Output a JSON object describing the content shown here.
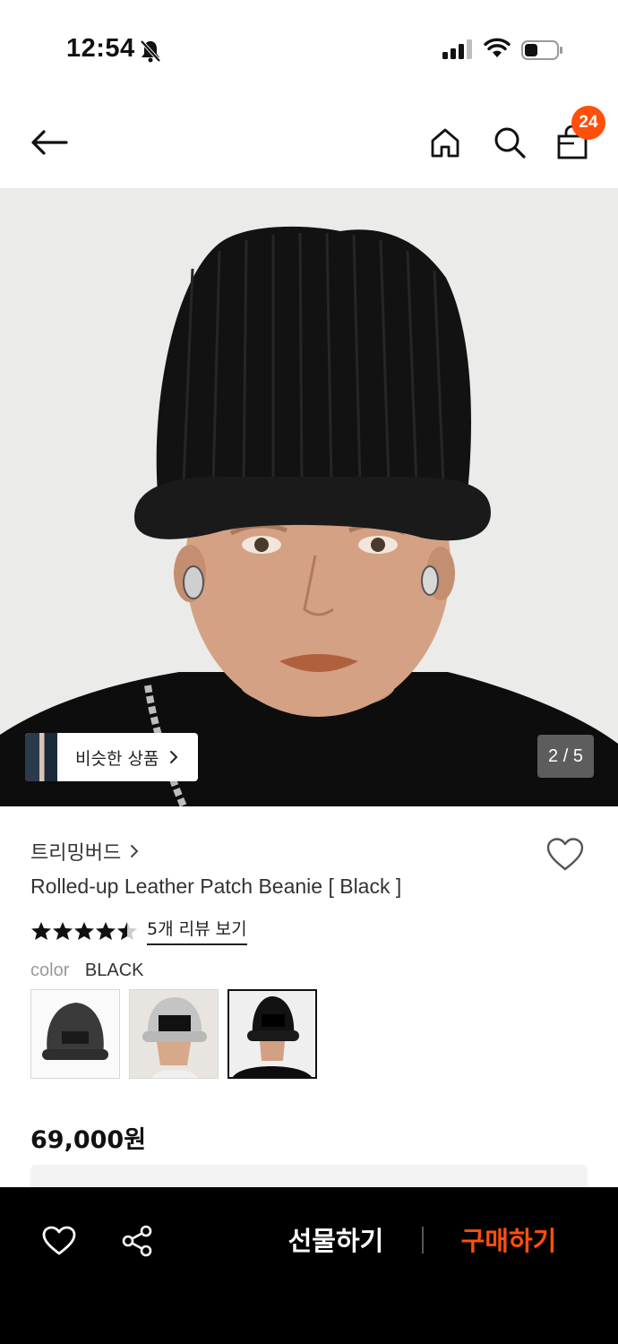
{
  "status_bar": {
    "time": "12:54",
    "icons": [
      "bell-off-icon",
      "signal-icon",
      "wifi-icon",
      "battery-icon"
    ]
  },
  "header": {
    "icons": [
      "arrow-left-icon",
      "home-icon",
      "search-icon",
      "shopping-bag-icon"
    ],
    "cart_count": "24",
    "badge_color": "#ff4f0a"
  },
  "gallery": {
    "similar_label": "비슷한 상품",
    "page_indicator": "2 / 5",
    "current_page": 2,
    "total_pages": 5
  },
  "product": {
    "brand": "트리밍버드",
    "name": "Rolled-up Leather Patch Beanie [ Black ]",
    "rating": 4.5,
    "review_link": "5개 리뷰 보기",
    "color_label": "color",
    "color_value": "BLACK",
    "swatches": [
      "charcoal",
      "light-grey",
      "black"
    ],
    "selected_swatch": "black",
    "price": "69,000원"
  },
  "bottom_bar": {
    "gift_label": "선물하기",
    "buy_label": "구매하기",
    "accent": "#ff4f0a",
    "icons": [
      "heart-icon",
      "share-icon"
    ]
  }
}
